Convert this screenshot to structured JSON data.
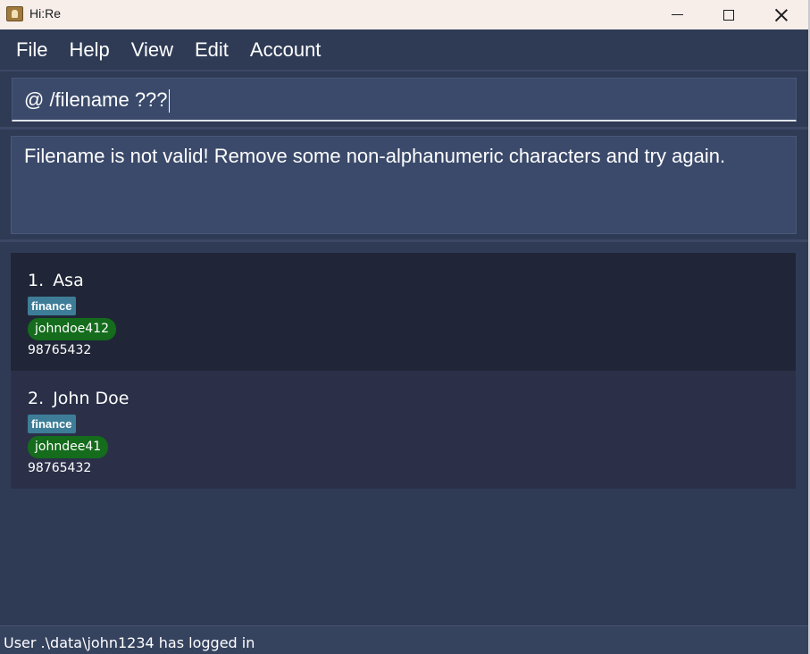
{
  "window": {
    "title": "Hi:Re"
  },
  "menu": [
    {
      "label": "File"
    },
    {
      "label": "Help"
    },
    {
      "label": "View"
    },
    {
      "label": "Edit"
    },
    {
      "label": "Account"
    }
  ],
  "command": {
    "value": "@ /filename ???"
  },
  "result": {
    "message": "Filename is not valid! Remove some non-alphanumeric characters and try again."
  },
  "persons": [
    {
      "index": "1.",
      "name": "Asa",
      "tag": "finance",
      "username": "johndoe412",
      "phone": "98765432"
    },
    {
      "index": "2.",
      "name": "John Doe",
      "tag": "finance",
      "username": "johndee41",
      "phone": "98765432"
    }
  ],
  "status": {
    "text": "User .\\data\\john1234 has logged in"
  },
  "colors": {
    "background": "#2f3b55",
    "tag": "#3e7d98",
    "username_pill": "#146c1c"
  }
}
